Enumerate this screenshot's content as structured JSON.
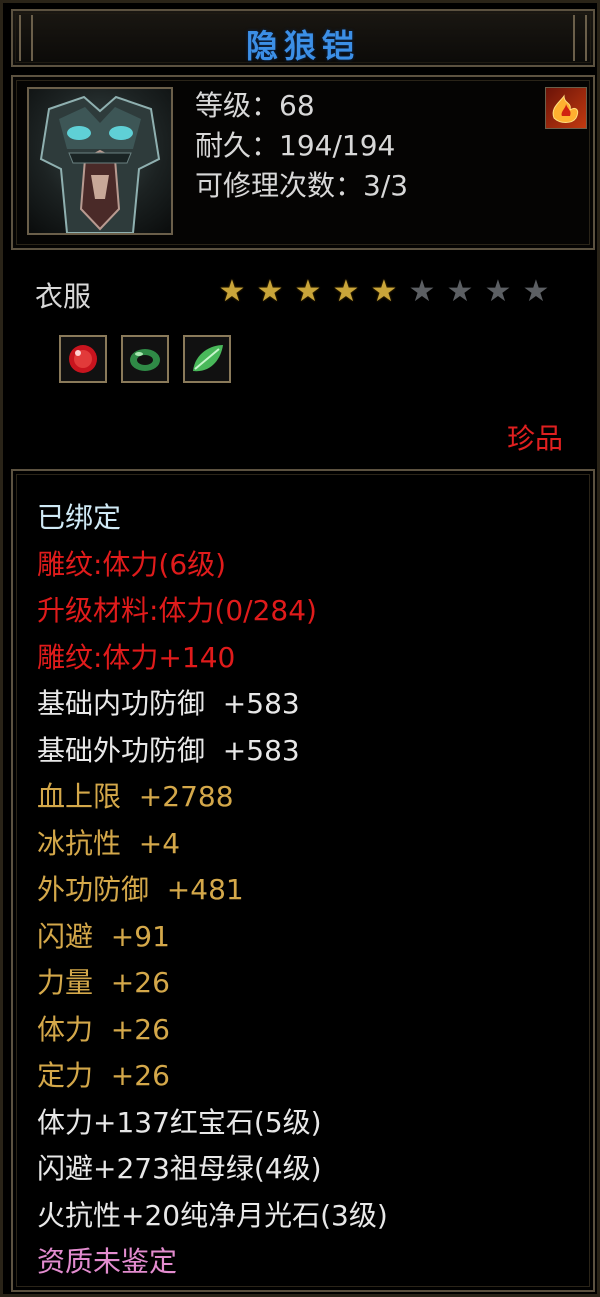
{
  "item_name": "隐狼铠",
  "stats": {
    "level": "等级：68",
    "durability": "耐久：194/194",
    "repair_count": "可修理次数：3/3"
  },
  "element_icon": "fire-element-icon",
  "item_type": "衣服",
  "star_rating": {
    "filled": 5,
    "total": 9
  },
  "gem_sockets": [
    {
      "icon": "ruby-gem-icon",
      "color": "#d11a2a"
    },
    {
      "icon": "jade-ring-icon",
      "color": "#3fa055"
    },
    {
      "icon": "jade-leaf-icon",
      "color": "#5fd06a"
    }
  ],
  "rarity": "珍品",
  "attributes": [
    {
      "text": "已绑定",
      "color": "cyan"
    },
    {
      "text": "雕纹:体力(6级)",
      "color": "red"
    },
    {
      "text": "升级材料:体力(0/284)",
      "color": "red"
    },
    {
      "text": "雕纹:体力+140",
      "color": "red"
    },
    {
      "text": "基础内功防御  +583",
      "color": "white"
    },
    {
      "text": "基础外功防御  +583",
      "color": "white"
    },
    {
      "text": "血上限  +2788",
      "color": "gold"
    },
    {
      "text": "冰抗性  +4",
      "color": "gold"
    },
    {
      "text": "外功防御  +481",
      "color": "gold"
    },
    {
      "text": "闪避  +91",
      "color": "gold"
    },
    {
      "text": "力量  +26",
      "color": "gold"
    },
    {
      "text": "体力  +26",
      "color": "gold"
    },
    {
      "text": "定力  +26",
      "color": "gold"
    },
    {
      "text": "体力+137红宝石(5级)",
      "color": "white"
    },
    {
      "text": "闪避+273祖母绿(4级)",
      "color": "white"
    },
    {
      "text": "火抗性+20纯净月光石(3级)",
      "color": "white"
    },
    {
      "text": "资质未鉴定",
      "color": "pink"
    }
  ]
}
